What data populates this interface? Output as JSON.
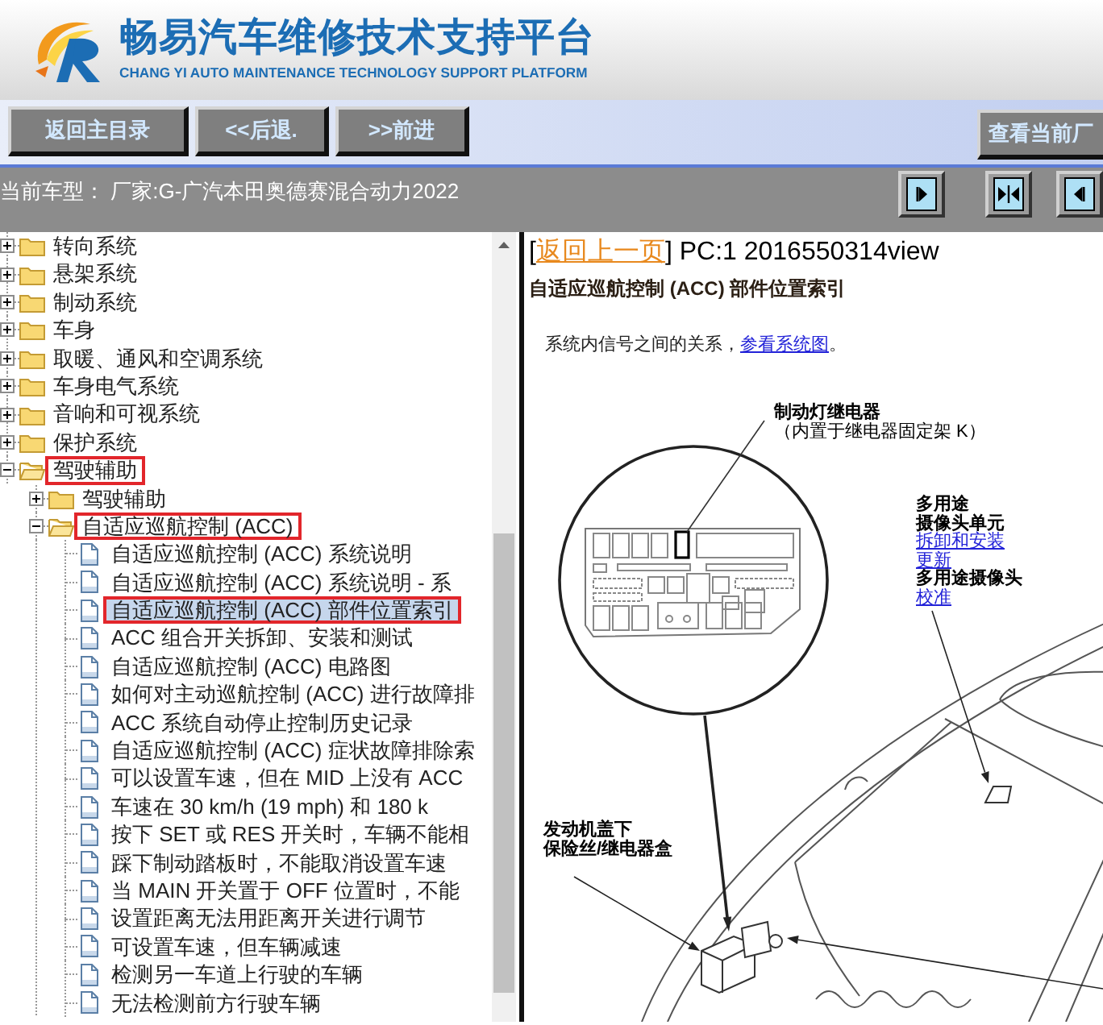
{
  "header": {
    "title": "畅易汽车维修技术支持平台",
    "subtitle": "CHANG YI AUTO MAINTENANCE TECHNOLOGY SUPPORT PLATFORM"
  },
  "toolbar": {
    "buttons": [
      "返回主目录",
      "<<后退.",
      ">>前进"
    ],
    "right_button": "查看当前厂"
  },
  "vehicle_bar": {
    "text": "当前车型： 厂家:G-广汽本田奥德赛混合动力2022"
  },
  "tree": {
    "items": [
      {
        "kind": "folder",
        "label": "转向系统",
        "expanded": false,
        "selected": false,
        "outlined": false
      },
      {
        "kind": "folder",
        "label": "悬架系统",
        "expanded": false,
        "selected": false,
        "outlined": false
      },
      {
        "kind": "folder",
        "label": "制动系统",
        "expanded": false,
        "selected": false,
        "outlined": false
      },
      {
        "kind": "folder",
        "label": "车身",
        "expanded": false,
        "selected": false,
        "outlined": false
      },
      {
        "kind": "folder",
        "label": "取暖、通风和空调系统",
        "expanded": false,
        "selected": false,
        "outlined": false
      },
      {
        "kind": "folder",
        "label": "车身电气系统",
        "expanded": false,
        "selected": false,
        "outlined": false
      },
      {
        "kind": "folder",
        "label": "音响和可视系统",
        "expanded": false,
        "selected": false,
        "outlined": false
      },
      {
        "kind": "folder",
        "label": "保护系统",
        "expanded": false,
        "selected": false,
        "outlined": false
      },
      {
        "kind": "folder",
        "label": "驾驶辅助",
        "expanded": true,
        "selected": false,
        "outlined": true,
        "children": [
          {
            "kind": "folder",
            "label": "驾驶辅助",
            "expanded": false,
            "selected": false,
            "outlined": false
          },
          {
            "kind": "folder",
            "label": "自适应巡航控制 (ACC)",
            "expanded": true,
            "selected": false,
            "outlined": true,
            "children": [
              {
                "kind": "page",
                "label": "自适应巡航控制 (ACC) 系统说明",
                "selected": false,
                "outlined": false
              },
              {
                "kind": "page",
                "label": "自适应巡航控制 (ACC) 系统说明 - 系",
                "selected": false,
                "outlined": false
              },
              {
                "kind": "page",
                "label": "自适应巡航控制 (ACC) 部件位置索引",
                "selected": true,
                "outlined": true
              },
              {
                "kind": "page",
                "label": "ACC 组合开关拆卸、安装和测试",
                "selected": false,
                "outlined": false
              },
              {
                "kind": "page",
                "label": "自适应巡航控制 (ACC) 电路图",
                "selected": false,
                "outlined": false
              },
              {
                "kind": "page",
                "label": "如何对主动巡航控制 (ACC) 进行故障排",
                "selected": false,
                "outlined": false
              },
              {
                "kind": "page",
                "label": "ACC 系统自动停止控制历史记录",
                "selected": false,
                "outlined": false
              },
              {
                "kind": "page",
                "label": "自适应巡航控制 (ACC) 症状故障排除索",
                "selected": false,
                "outlined": false
              },
              {
                "kind": "page",
                "label": "可以设置车速，但在 MID 上没有 ACC",
                "selected": false,
                "outlined": false
              },
              {
                "kind": "page",
                "label": "车速在 30 km/h (19 mph) 和 180 k",
                "selected": false,
                "outlined": false
              },
              {
                "kind": "page",
                "label": "按下 SET 或 RES 开关时，车辆不能相",
                "selected": false,
                "outlined": false
              },
              {
                "kind": "page",
                "label": "踩下制动踏板时，不能取消设置车速",
                "selected": false,
                "outlined": false
              },
              {
                "kind": "page",
                "label": "当 MAIN 开关置于 OFF 位置时，不能",
                "selected": false,
                "outlined": false
              },
              {
                "kind": "page",
                "label": "设置距离无法用距离开关进行调节",
                "selected": false,
                "outlined": false
              },
              {
                "kind": "page",
                "label": "可设置车速，但车辆减速",
                "selected": false,
                "outlined": false
              },
              {
                "kind": "page",
                "label": "检测另一车道上行驶的车辆",
                "selected": false,
                "outlined": false
              },
              {
                "kind": "page",
                "label": "无法检测前方行驶车辆",
                "selected": false,
                "outlined": false
              }
            ]
          }
        ]
      }
    ]
  },
  "document": {
    "header": {
      "before": "[",
      "link": "返回上一页",
      "after": "] PC:1 2016550314view"
    },
    "title": "自适应巡航控制 (ACC) 部件位置索引",
    "intro": {
      "before": "系统内信号之间的关系，",
      "link": "参看系统图",
      "after": "。"
    },
    "diagram": {
      "callouts": [
        {
          "lines": [
            {
              "kind": "label",
              "text": "制动灯继电器"
            },
            {
              "kind": "note",
              "text": "（内置于继电器固定架 K）"
            }
          ]
        },
        {
          "lines": [
            {
              "kind": "label",
              "text": "多用途"
            },
            {
              "kind": "label",
              "text": "摄像头单元"
            },
            {
              "kind": "link",
              "text": "拆卸和安装"
            },
            {
              "kind": "link",
              "text": "更新"
            },
            {
              "kind": "label",
              "text": "多用途摄像头"
            },
            {
              "kind": "link",
              "text": "校准"
            }
          ]
        },
        {
          "lines": [
            {
              "kind": "label",
              "text": "发动机盖下"
            },
            {
              "kind": "label",
              "text": "保险丝/继电器盒"
            }
          ]
        }
      ]
    }
  }
}
